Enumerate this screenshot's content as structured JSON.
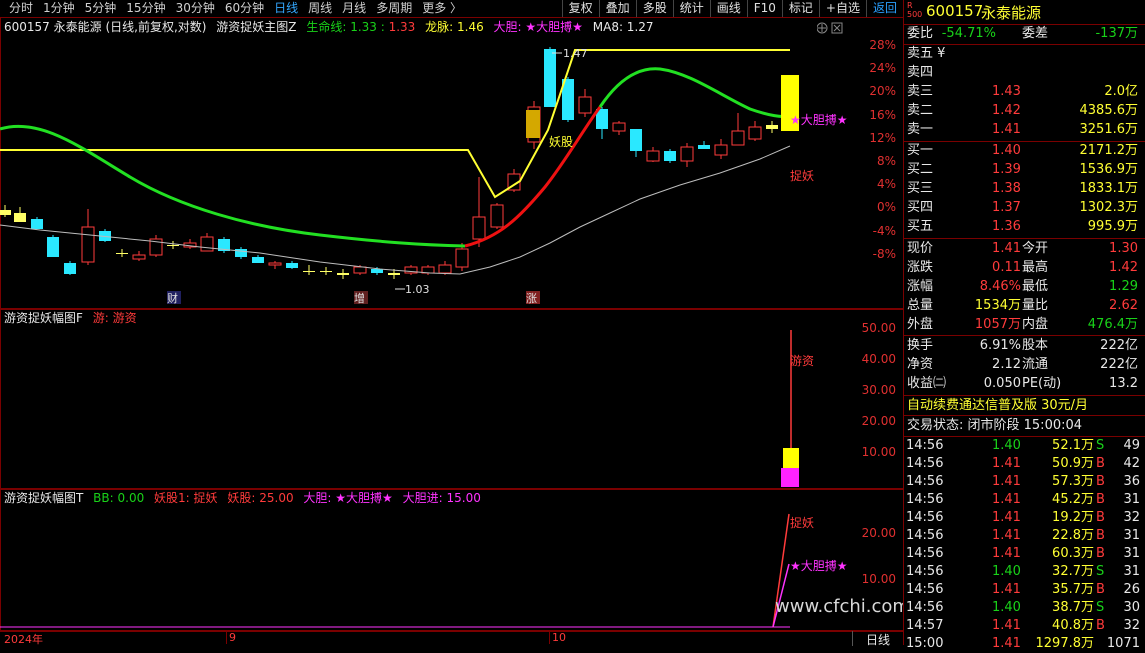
{
  "toolbar": {
    "periods": [
      "分时",
      "1分钟",
      "5分钟",
      "15分钟",
      "30分钟",
      "60分钟",
      "日线",
      "周线",
      "月线",
      "多周期",
      "更多 〉"
    ],
    "active_period": "日线",
    "tools": [
      "复权",
      "叠加",
      "多股",
      "统计",
      "画线",
      "F10",
      "标记",
      "+自选"
    ],
    "back": "返回"
  },
  "main_title": {
    "stock": "600157 永泰能源",
    "mode": "(日线,前复权,对数)",
    "indicator": "游资捉妖主图Z",
    "life_label": "生命线: 1.33",
    "life_val2": "1.33",
    "dragon": "龙脉: 1.46",
    "bold": "大胆: ★大胆搏★",
    "ma": "MA8: 1.27"
  },
  "main_axis": [
    "28%",
    "24%",
    "20%",
    "16%",
    "12%",
    "8%",
    "4%",
    "0%",
    "-4%",
    "-8%"
  ],
  "main_annotations": {
    "high": "1.47",
    "low": "1.03",
    "yaogu": "妖股",
    "dadan": "★大胆搏★",
    "zhuoyao": "捉妖",
    "m1": "财",
    "m2": "增",
    "m3": "涨"
  },
  "panel2": {
    "title": "游资捉妖幅图F",
    "sub": "游: 游资",
    "axis": [
      "50.00",
      "40.00",
      "30.00",
      "20.00",
      "10.00"
    ],
    "label": "游资"
  },
  "panel3": {
    "title": "游资捉妖幅图T",
    "bb": "BB: 0.00",
    "yao": "妖股1: 捉妖",
    "yao2": "妖股: 25.00",
    "dadan": "大胆: ★大胆搏★",
    "jin": "大胆进: 15.00",
    "axis": [
      "20.00",
      "10.00"
    ],
    "label1": "捉妖",
    "label2": "★大胆搏★"
  },
  "x_axis": {
    "labels": [
      "2024年",
      "9",
      "10"
    ],
    "period": "日线"
  },
  "watermark": "www.cfchi.com",
  "quote": {
    "code": "600157",
    "name": "永泰能源",
    "r_badge": "R",
    "r_num": "500",
    "weibi_label": "委比",
    "weibi": "-54.71%",
    "weicha_label": "委差",
    "weicha": "-137万",
    "sell5": "卖五 ¥",
    "sell": [
      {
        "label": "卖四",
        "price": "",
        "vol": ""
      },
      {
        "label": "卖三",
        "price": "1.43",
        "vol": "2.0亿"
      },
      {
        "label": "卖二",
        "price": "1.42",
        "vol": "4385.6万"
      },
      {
        "label": "卖一",
        "price": "1.41",
        "vol": "3251.6万"
      }
    ],
    "buy": [
      {
        "label": "买一",
        "price": "1.40",
        "vol": "2171.2万"
      },
      {
        "label": "买二",
        "price": "1.39",
        "vol": "1536.9万"
      },
      {
        "label": "买三",
        "price": "1.38",
        "vol": "1833.1万"
      },
      {
        "label": "买四",
        "price": "1.37",
        "vol": "1302.3万"
      },
      {
        "label": "买五",
        "price": "1.36",
        "vol": "995.9万"
      }
    ],
    "stats": [
      {
        "l1": "现价",
        "v1": "1.41",
        "l2": "今开",
        "v2": "1.30"
      },
      {
        "l1": "涨跌",
        "v1": "0.11",
        "l2": "最高",
        "v2": "1.42"
      },
      {
        "l1": "涨幅",
        "v1": "8.46%",
        "l2": "最低",
        "v2": "1.29"
      },
      {
        "l1": "总量",
        "v1": "1534万",
        "l2": "量比",
        "v2": "2.62"
      },
      {
        "l1": "外盘",
        "v1": "1057万",
        "l2": "内盘",
        "v2": "476.4万"
      }
    ],
    "stats2": [
      {
        "l1": "换手",
        "v1": "6.91%",
        "l2": "股本",
        "v2": "222亿"
      },
      {
        "l1": "净资",
        "v1": "2.12",
        "l2": "流通",
        "v2": "222亿"
      },
      {
        "l1": "收益㈡",
        "v1": "0.050",
        "l2": "PE(动)",
        "v2": "13.2"
      }
    ],
    "ad": "自动续费通达信普及版  30元/月",
    "status": "交易状态: 闭市阶段 15:00:04",
    "ticks": [
      {
        "t": "14:56",
        "p": "1.40",
        "v": "52.1万",
        "s": "S",
        "n": "49"
      },
      {
        "t": "14:56",
        "p": "1.41",
        "v": "50.9万",
        "s": "B",
        "n": "42"
      },
      {
        "t": "14:56",
        "p": "1.41",
        "v": "57.3万",
        "s": "B",
        "n": "36"
      },
      {
        "t": "14:56",
        "p": "1.41",
        "v": "45.2万",
        "s": "B",
        "n": "31"
      },
      {
        "t": "14:56",
        "p": "1.41",
        "v": "19.2万",
        "s": "B",
        "n": "32"
      },
      {
        "t": "14:56",
        "p": "1.41",
        "v": "22.8万",
        "s": "B",
        "n": "31"
      },
      {
        "t": "14:56",
        "p": "1.41",
        "v": "60.3万",
        "s": "B",
        "n": "31"
      },
      {
        "t": "14:56",
        "p": "1.40",
        "v": "32.7万",
        "s": "S",
        "n": "31"
      },
      {
        "t": "14:56",
        "p": "1.41",
        "v": "35.7万",
        "s": "B",
        "n": "26"
      },
      {
        "t": "14:56",
        "p": "1.40",
        "v": "38.7万",
        "s": "S",
        "n": "30"
      },
      {
        "t": "14:57",
        "p": "1.41",
        "v": "40.8万",
        "s": "B",
        "n": "32"
      },
      {
        "t": "15:00",
        "p": "1.41",
        "v": "1297.8万",
        "s": "",
        "n": "1071"
      }
    ]
  }
}
